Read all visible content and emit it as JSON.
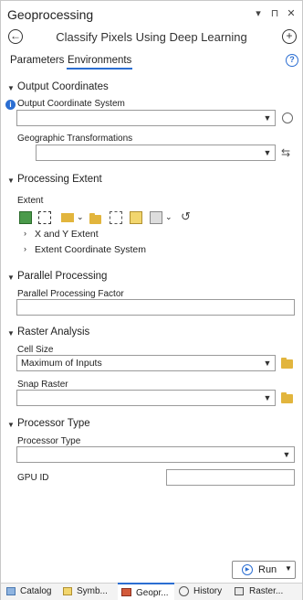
{
  "app": {
    "title": "Geoprocessing"
  },
  "window_controls": [
    "▾",
    "⊓",
    "✕"
  ],
  "tool": {
    "title": "Classify Pixels Using Deep Learning",
    "back_icon": "back-arrow-icon",
    "add_icon": "plus-icon"
  },
  "tabs": [
    {
      "label": "Parameters"
    },
    {
      "label": "Environments"
    }
  ],
  "sections": {
    "output_coordinates": {
      "title": "Output Coordinates",
      "output_cs_label": "Output Coordinate System",
      "geo_transform_label": "Geographic Transformations"
    },
    "processing_extent": {
      "title": "Processing Extent",
      "extent_label": "Extent",
      "sub_items": [
        "X and Y Extent",
        "Extent Coordinate System"
      ]
    },
    "parallel_processing": {
      "title": "Parallel Processing",
      "factor_label": "Parallel Processing Factor"
    },
    "raster_analysis": {
      "title": "Raster Analysis",
      "cell_size_label": "Cell Size",
      "cell_size_value": "Maximum of Inputs",
      "snap_raster_label": "Snap Raster"
    },
    "processor_type": {
      "title": "Processor Type",
      "processor_label": "Processor Type",
      "gpu_id_label": "GPU ID"
    }
  },
  "run_button": {
    "label": "Run"
  },
  "bottom_tabs": [
    {
      "label": "Catalog",
      "icon": "catalog-icon"
    },
    {
      "label": "Symb...",
      "icon": "symbology-icon"
    },
    {
      "label": "Geopr...",
      "icon": "toolbox-icon",
      "active": true
    },
    {
      "label": "History",
      "icon": "history-icon"
    },
    {
      "label": "Raster...",
      "icon": "raster-functions-icon"
    }
  ],
  "colors": {
    "accent": "#2b6ed2",
    "folder": "#e2b53d"
  }
}
